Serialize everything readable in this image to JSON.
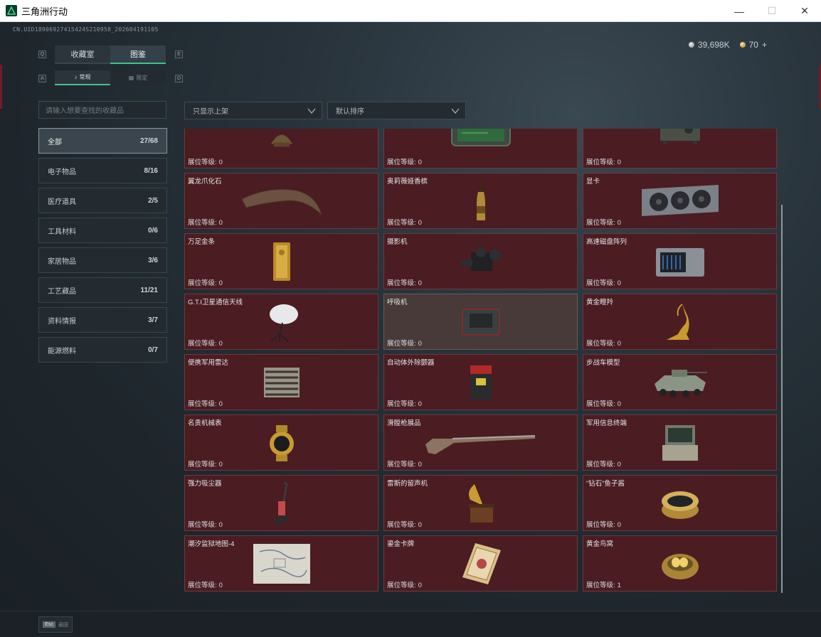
{
  "window": {
    "title": "三角洲行动",
    "controls": {
      "minimize": "—",
      "maximize": "☐",
      "close": "✕"
    }
  },
  "header": {
    "uid": "CN.UID18906927415424S210958_202604191105",
    "silver": "39,698K",
    "gold": "70",
    "gold_add": "+"
  },
  "nav": {
    "tabs": [
      {
        "label": "收藏室"
      },
      {
        "label": "图鉴"
      }
    ],
    "subtabs": [
      {
        "label": "常规"
      },
      {
        "label": "限定"
      }
    ],
    "keycaps": {
      "tab_left": "Q",
      "tab_right": "E",
      "sub_left": "A",
      "sub_right": "D"
    }
  },
  "search": {
    "placeholder": "请输入想要查找的收藏品"
  },
  "filters": {
    "display": "只显示上架",
    "sort": "默认排序"
  },
  "categories": [
    {
      "label": "全部",
      "count": "27/68"
    },
    {
      "label": "电子物品",
      "count": "8/16"
    },
    {
      "label": "医疗道具",
      "count": "2/5"
    },
    {
      "label": "工具材料",
      "count": "0/6"
    },
    {
      "label": "家居物品",
      "count": "3/6"
    },
    {
      "label": "工艺藏品",
      "count": "11/21"
    },
    {
      "label": "资料情报",
      "count": "3/7"
    },
    {
      "label": "能源燃料",
      "count": "0/7"
    }
  ],
  "level_label": "展位等级:",
  "items": [
    {
      "name": "",
      "level": "0",
      "icon": "bust-icon"
    },
    {
      "name": "",
      "level": "0",
      "icon": "circuit-case-icon"
    },
    {
      "name": "",
      "level": "0",
      "icon": "radio-device-icon"
    },
    {
      "name": "翼龙爪化石",
      "level": "0",
      "icon": "claw-fossil-icon"
    },
    {
      "name": "奥莉薇娅香槟",
      "level": "0",
      "icon": "champagne-icon"
    },
    {
      "name": "显卡",
      "level": "0",
      "icon": "graphics-card-icon"
    },
    {
      "name": "万足金条",
      "level": "0",
      "icon": "gold-bar-icon"
    },
    {
      "name": "摄影机",
      "level": "0",
      "icon": "camera-icon"
    },
    {
      "name": "高速磁盘阵列",
      "level": "0",
      "icon": "disk-array-icon"
    },
    {
      "name": "G.T.I卫星通信天线",
      "level": "0",
      "icon": "satellite-dish-icon"
    },
    {
      "name": "呼吸机",
      "level": "0",
      "icon": "ventilator-icon"
    },
    {
      "name": "黄金瞪羚",
      "level": "0",
      "icon": "gold-gazelle-icon"
    },
    {
      "name": "便携军用雷达",
      "level": "0",
      "icon": "radar-icon"
    },
    {
      "name": "自动体外除颤器",
      "level": "0",
      "icon": "defibrillator-icon"
    },
    {
      "name": "步战车模型",
      "level": "0",
      "icon": "ifv-model-icon"
    },
    {
      "name": "名贵机械表",
      "level": "0",
      "icon": "watch-icon"
    },
    {
      "name": "滑膛枪展品",
      "level": "0",
      "icon": "musket-icon"
    },
    {
      "name": "军用信息终端",
      "level": "0",
      "icon": "terminal-icon"
    },
    {
      "name": "强力吸尘器",
      "level": "0",
      "icon": "vacuum-icon"
    },
    {
      "name": "雷斯的留声机",
      "level": "0",
      "icon": "gramophone-icon"
    },
    {
      "name": "“钻石”鱼子酱",
      "level": "0",
      "icon": "caviar-icon"
    },
    {
      "name": "潮汐监狱地图-4",
      "level": "0",
      "icon": "map-icon"
    },
    {
      "name": "鎏金卡牌",
      "level": "0",
      "icon": "gilded-card-icon"
    },
    {
      "name": "黄金鸟窝",
      "level": "1",
      "icon": "gold-nest-icon"
    }
  ],
  "footer": {
    "esc_key": "Esc",
    "esc_label": "返回"
  },
  "colors": {
    "accent": "#41c38a",
    "card_bg": "#4b1c21",
    "card_highlight_bg": "#473a38",
    "background": "#1e262c"
  }
}
